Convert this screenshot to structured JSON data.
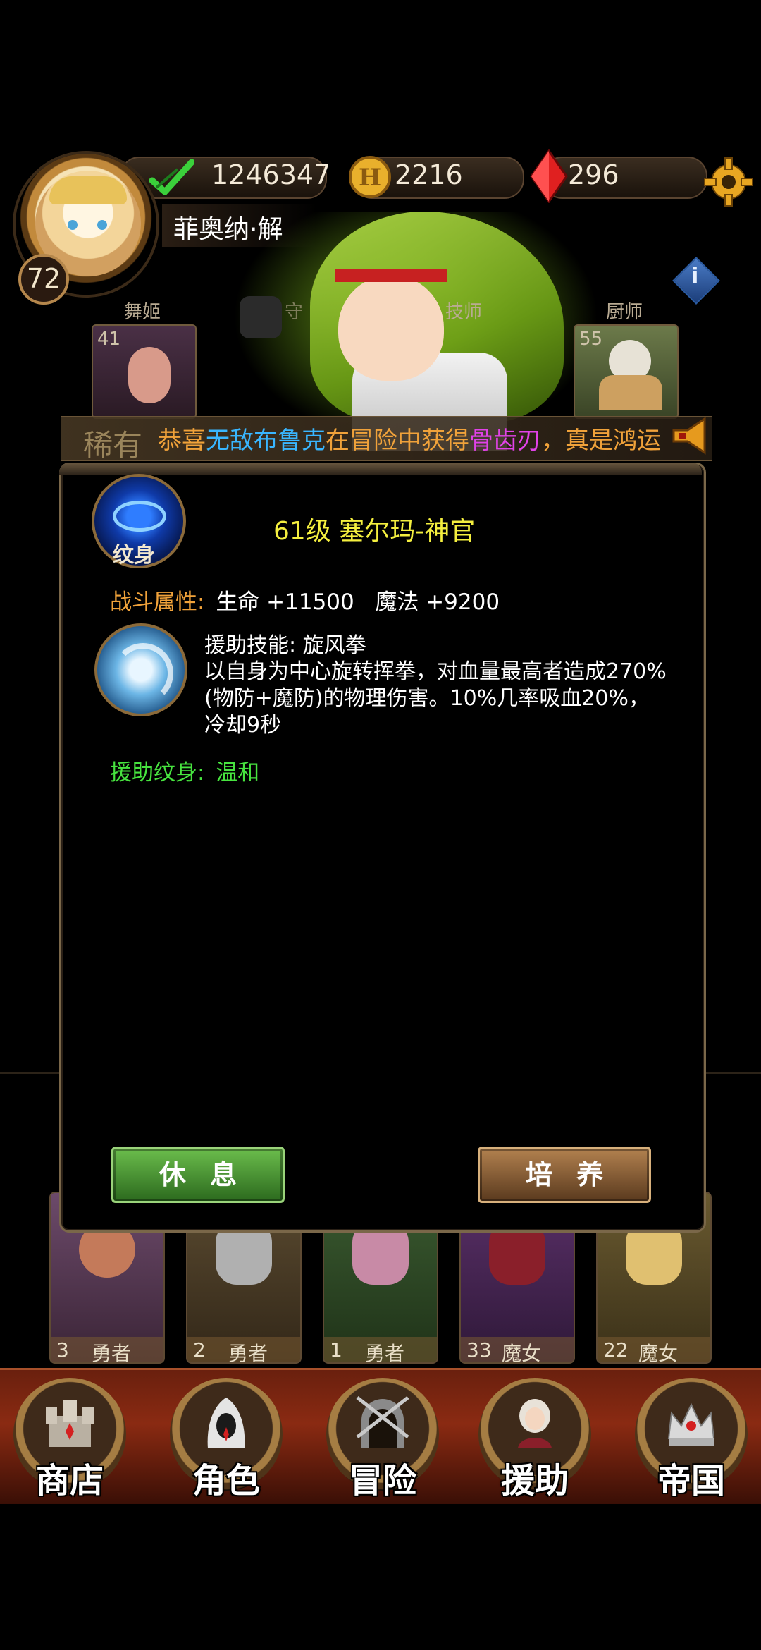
{
  "hud": {
    "player_level": "72",
    "player_name": "菲奥纳·解",
    "power": "1246347",
    "gold": "2216",
    "gems": "296",
    "icons": {
      "power": "green-check-sword-icon",
      "gold": "gold-coin-icon",
      "gems": "red-crystal-icon",
      "settings": "gear-icon"
    }
  },
  "slots": [
    {
      "label": "舞姬",
      "level": "41"
    },
    {
      "label": "守",
      "level": ""
    },
    {
      "label": "技师",
      "level": ""
    },
    {
      "label": "厨师",
      "level": "55"
    }
  ],
  "rarity": "稀有",
  "marquee": {
    "parts": [
      {
        "text": "恭喜",
        "color": "#f0a23a"
      },
      {
        "text": "无敌布鲁克",
        "color": "#39b6ff"
      },
      {
        "text": "在冒险中获得",
        "color": "#f0a23a"
      },
      {
        "text": "骨齿刃",
        "color": "#e142e8"
      },
      {
        "text": "，真是鸿运",
        "color": "#f0a23a"
      }
    ]
  },
  "dialog": {
    "tattoo_label": "纹身",
    "title": "61级 塞尔玛-神官",
    "stats_label": "战斗属性:",
    "stats_value": "生命 +11500   魔法 +9200",
    "skill_name": "援助技能: 旋风拳",
    "skill_desc": "以自身为中心旋转挥拳，对血量最高者造成270%(物防+魔防)的物理伤害。10%几率吸血20%，冷却9秒",
    "tattoo_line_label": "援助纹身:",
    "tattoo_line_value": "温和",
    "rest_button": "休息",
    "train_button": "培养",
    "colors": {
      "title": "#f4ef3f",
      "label": "#f0a23a",
      "green": "#47e33f"
    }
  },
  "heroes": [
    {
      "level": "3",
      "class": "勇者"
    },
    {
      "level": "2",
      "class": "勇者"
    },
    {
      "level": "1",
      "class": "勇者"
    },
    {
      "level": "33",
      "class": "魔女"
    },
    {
      "level": "22",
      "class": "魔女"
    }
  ],
  "nav": [
    {
      "label": "商店",
      "icon": "castle-icon"
    },
    {
      "label": "角色",
      "icon": "hooded-figure-icon"
    },
    {
      "label": "冒险",
      "icon": "dungeon-gate-icon"
    },
    {
      "label": "援助",
      "icon": "assistant-portrait-icon"
    },
    {
      "label": "帝国",
      "icon": "crown-icon"
    }
  ]
}
